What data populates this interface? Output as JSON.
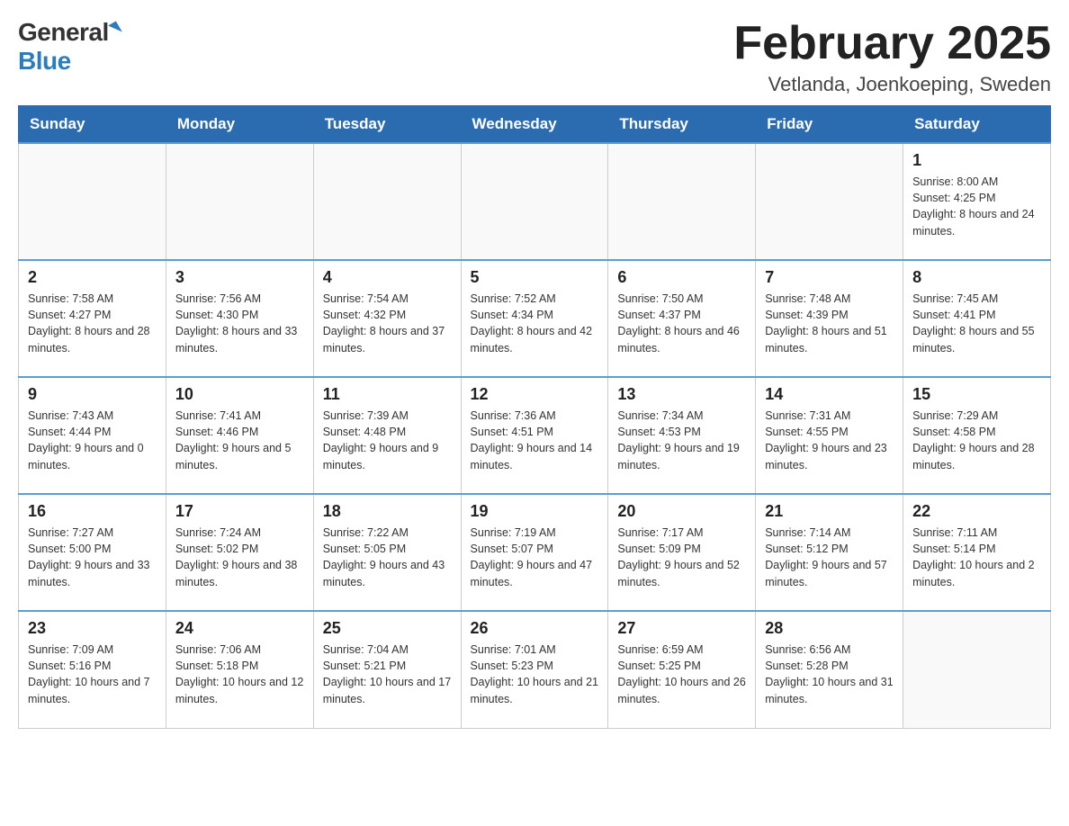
{
  "logo": {
    "general": "General",
    "blue": "Blue"
  },
  "header": {
    "title": "February 2025",
    "subtitle": "Vetlanda, Joenkoeping, Sweden"
  },
  "weekdays": [
    "Sunday",
    "Monday",
    "Tuesday",
    "Wednesday",
    "Thursday",
    "Friday",
    "Saturday"
  ],
  "weeks": [
    [
      {
        "day": "",
        "sunrise": "",
        "sunset": "",
        "daylight": ""
      },
      {
        "day": "",
        "sunrise": "",
        "sunset": "",
        "daylight": ""
      },
      {
        "day": "",
        "sunrise": "",
        "sunset": "",
        "daylight": ""
      },
      {
        "day": "",
        "sunrise": "",
        "sunset": "",
        "daylight": ""
      },
      {
        "day": "",
        "sunrise": "",
        "sunset": "",
        "daylight": ""
      },
      {
        "day": "",
        "sunrise": "",
        "sunset": "",
        "daylight": ""
      },
      {
        "day": "1",
        "sunrise": "Sunrise: 8:00 AM",
        "sunset": "Sunset: 4:25 PM",
        "daylight": "Daylight: 8 hours and 24 minutes."
      }
    ],
    [
      {
        "day": "2",
        "sunrise": "Sunrise: 7:58 AM",
        "sunset": "Sunset: 4:27 PM",
        "daylight": "Daylight: 8 hours and 28 minutes."
      },
      {
        "day": "3",
        "sunrise": "Sunrise: 7:56 AM",
        "sunset": "Sunset: 4:30 PM",
        "daylight": "Daylight: 8 hours and 33 minutes."
      },
      {
        "day": "4",
        "sunrise": "Sunrise: 7:54 AM",
        "sunset": "Sunset: 4:32 PM",
        "daylight": "Daylight: 8 hours and 37 minutes."
      },
      {
        "day": "5",
        "sunrise": "Sunrise: 7:52 AM",
        "sunset": "Sunset: 4:34 PM",
        "daylight": "Daylight: 8 hours and 42 minutes."
      },
      {
        "day": "6",
        "sunrise": "Sunrise: 7:50 AM",
        "sunset": "Sunset: 4:37 PM",
        "daylight": "Daylight: 8 hours and 46 minutes."
      },
      {
        "day": "7",
        "sunrise": "Sunrise: 7:48 AM",
        "sunset": "Sunset: 4:39 PM",
        "daylight": "Daylight: 8 hours and 51 minutes."
      },
      {
        "day": "8",
        "sunrise": "Sunrise: 7:45 AM",
        "sunset": "Sunset: 4:41 PM",
        "daylight": "Daylight: 8 hours and 55 minutes."
      }
    ],
    [
      {
        "day": "9",
        "sunrise": "Sunrise: 7:43 AM",
        "sunset": "Sunset: 4:44 PM",
        "daylight": "Daylight: 9 hours and 0 minutes."
      },
      {
        "day": "10",
        "sunrise": "Sunrise: 7:41 AM",
        "sunset": "Sunset: 4:46 PM",
        "daylight": "Daylight: 9 hours and 5 minutes."
      },
      {
        "day": "11",
        "sunrise": "Sunrise: 7:39 AM",
        "sunset": "Sunset: 4:48 PM",
        "daylight": "Daylight: 9 hours and 9 minutes."
      },
      {
        "day": "12",
        "sunrise": "Sunrise: 7:36 AM",
        "sunset": "Sunset: 4:51 PM",
        "daylight": "Daylight: 9 hours and 14 minutes."
      },
      {
        "day": "13",
        "sunrise": "Sunrise: 7:34 AM",
        "sunset": "Sunset: 4:53 PM",
        "daylight": "Daylight: 9 hours and 19 minutes."
      },
      {
        "day": "14",
        "sunrise": "Sunrise: 7:31 AM",
        "sunset": "Sunset: 4:55 PM",
        "daylight": "Daylight: 9 hours and 23 minutes."
      },
      {
        "day": "15",
        "sunrise": "Sunrise: 7:29 AM",
        "sunset": "Sunset: 4:58 PM",
        "daylight": "Daylight: 9 hours and 28 minutes."
      }
    ],
    [
      {
        "day": "16",
        "sunrise": "Sunrise: 7:27 AM",
        "sunset": "Sunset: 5:00 PM",
        "daylight": "Daylight: 9 hours and 33 minutes."
      },
      {
        "day": "17",
        "sunrise": "Sunrise: 7:24 AM",
        "sunset": "Sunset: 5:02 PM",
        "daylight": "Daylight: 9 hours and 38 minutes."
      },
      {
        "day": "18",
        "sunrise": "Sunrise: 7:22 AM",
        "sunset": "Sunset: 5:05 PM",
        "daylight": "Daylight: 9 hours and 43 minutes."
      },
      {
        "day": "19",
        "sunrise": "Sunrise: 7:19 AM",
        "sunset": "Sunset: 5:07 PM",
        "daylight": "Daylight: 9 hours and 47 minutes."
      },
      {
        "day": "20",
        "sunrise": "Sunrise: 7:17 AM",
        "sunset": "Sunset: 5:09 PM",
        "daylight": "Daylight: 9 hours and 52 minutes."
      },
      {
        "day": "21",
        "sunrise": "Sunrise: 7:14 AM",
        "sunset": "Sunset: 5:12 PM",
        "daylight": "Daylight: 9 hours and 57 minutes."
      },
      {
        "day": "22",
        "sunrise": "Sunrise: 7:11 AM",
        "sunset": "Sunset: 5:14 PM",
        "daylight": "Daylight: 10 hours and 2 minutes."
      }
    ],
    [
      {
        "day": "23",
        "sunrise": "Sunrise: 7:09 AM",
        "sunset": "Sunset: 5:16 PM",
        "daylight": "Daylight: 10 hours and 7 minutes."
      },
      {
        "day": "24",
        "sunrise": "Sunrise: 7:06 AM",
        "sunset": "Sunset: 5:18 PM",
        "daylight": "Daylight: 10 hours and 12 minutes."
      },
      {
        "day": "25",
        "sunrise": "Sunrise: 7:04 AM",
        "sunset": "Sunset: 5:21 PM",
        "daylight": "Daylight: 10 hours and 17 minutes."
      },
      {
        "day": "26",
        "sunrise": "Sunrise: 7:01 AM",
        "sunset": "Sunset: 5:23 PM",
        "daylight": "Daylight: 10 hours and 21 minutes."
      },
      {
        "day": "27",
        "sunrise": "Sunrise: 6:59 AM",
        "sunset": "Sunset: 5:25 PM",
        "daylight": "Daylight: 10 hours and 26 minutes."
      },
      {
        "day": "28",
        "sunrise": "Sunrise: 6:56 AM",
        "sunset": "Sunset: 5:28 PM",
        "daylight": "Daylight: 10 hours and 31 minutes."
      },
      {
        "day": "",
        "sunrise": "",
        "sunset": "",
        "daylight": ""
      }
    ]
  ]
}
